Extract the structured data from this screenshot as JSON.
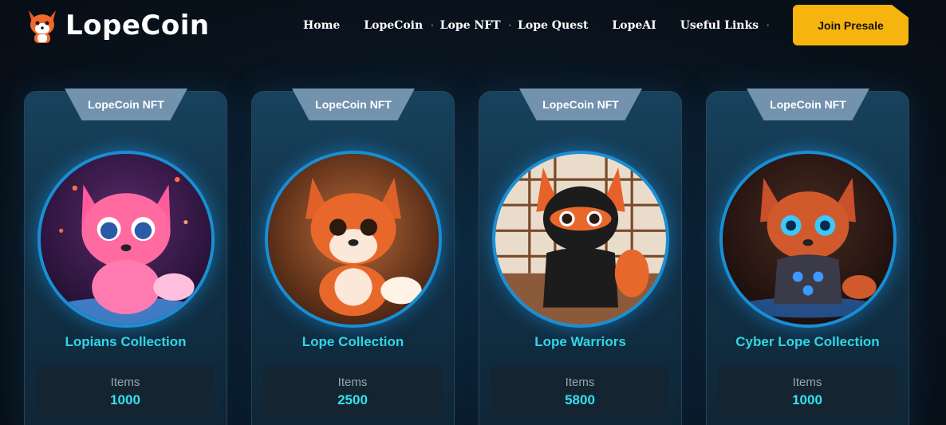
{
  "header": {
    "brand": "LopeCoin",
    "nav": [
      {
        "label": "Home",
        "has_dropdown": false
      },
      {
        "label": "LopeCoin",
        "has_dropdown": true
      },
      {
        "label": "Lope NFT",
        "has_dropdown": true
      },
      {
        "label": "Lope Quest",
        "has_dropdown": false
      },
      {
        "label": "LopeAI",
        "has_dropdown": false
      },
      {
        "label": "Useful Links",
        "has_dropdown": true
      }
    ],
    "dropdown_marker": "·",
    "cta": "Join Presale"
  },
  "cards": [
    {
      "tag": "LopeCoin NFT",
      "title": "Lopians Collection",
      "items_label": "Items",
      "items_value": "1000"
    },
    {
      "tag": "LopeCoin NFT",
      "title": "Lope Collection",
      "items_label": "Items",
      "items_value": "2500"
    },
    {
      "tag": "LopeCoin NFT",
      "title": "Lope Warriors",
      "items_label": "Items",
      "items_value": "5800"
    },
    {
      "tag": "LopeCoin NFT",
      "title": "Cyber Lope Collection",
      "items_label": "Items",
      "items_value": "1000"
    }
  ],
  "colors": {
    "accent": "#f6b40e",
    "title_cyan": "#2fd7e8",
    "ring_blue": "#1a8ed4",
    "card_tab": "#7292ad"
  }
}
